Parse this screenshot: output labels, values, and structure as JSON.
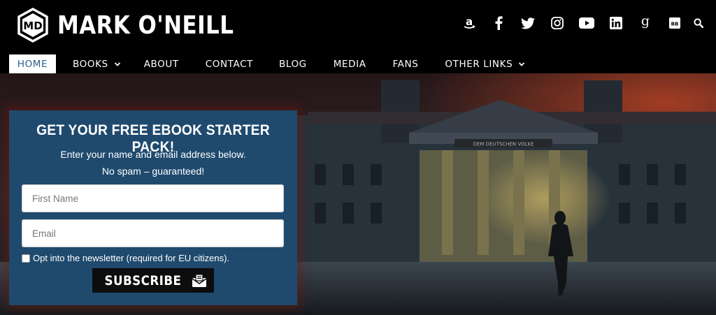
{
  "brand": {
    "name": "MARK O'NEILL",
    "logo_letters": "MD"
  },
  "social": [
    {
      "name": "amazon-icon"
    },
    {
      "name": "facebook-icon"
    },
    {
      "name": "twitter-icon"
    },
    {
      "name": "instagram-icon"
    },
    {
      "name": "youtube-icon"
    },
    {
      "name": "linkedin-icon"
    },
    {
      "name": "goodreads-icon"
    },
    {
      "name": "bookbub-icon",
      "text": "BB"
    },
    {
      "name": "search-icon"
    }
  ],
  "nav": {
    "items": [
      {
        "label": "HOME",
        "active": true
      },
      {
        "label": "BOOKS",
        "dropdown": true
      },
      {
        "label": "ABOUT"
      },
      {
        "label": "CONTACT"
      },
      {
        "label": "BLOG"
      },
      {
        "label": "MEDIA"
      },
      {
        "label": "FANS"
      },
      {
        "label": "OTHER LINKS",
        "dropdown": true
      }
    ]
  },
  "hero": {
    "inscription": "DEM DEUTSCHEN VOLKE"
  },
  "optin": {
    "title": "GET YOUR FREE EBOOK STARTER PACK!",
    "subtitle_line1": "Enter your name and email address below.",
    "subtitle_line2": "No spam – guaranteed!",
    "first_name_placeholder": "First Name",
    "email_placeholder": "Email",
    "consent_label": "Opt into the newsletter (required for EU citizens).",
    "subscribe_label": "SUBSCRIBE"
  },
  "colors": {
    "header_bg": "#000000",
    "active_nav_text": "#2a5d8f",
    "optin_bg": "#1f4a6e",
    "button_bg": "#0d0d0d"
  }
}
